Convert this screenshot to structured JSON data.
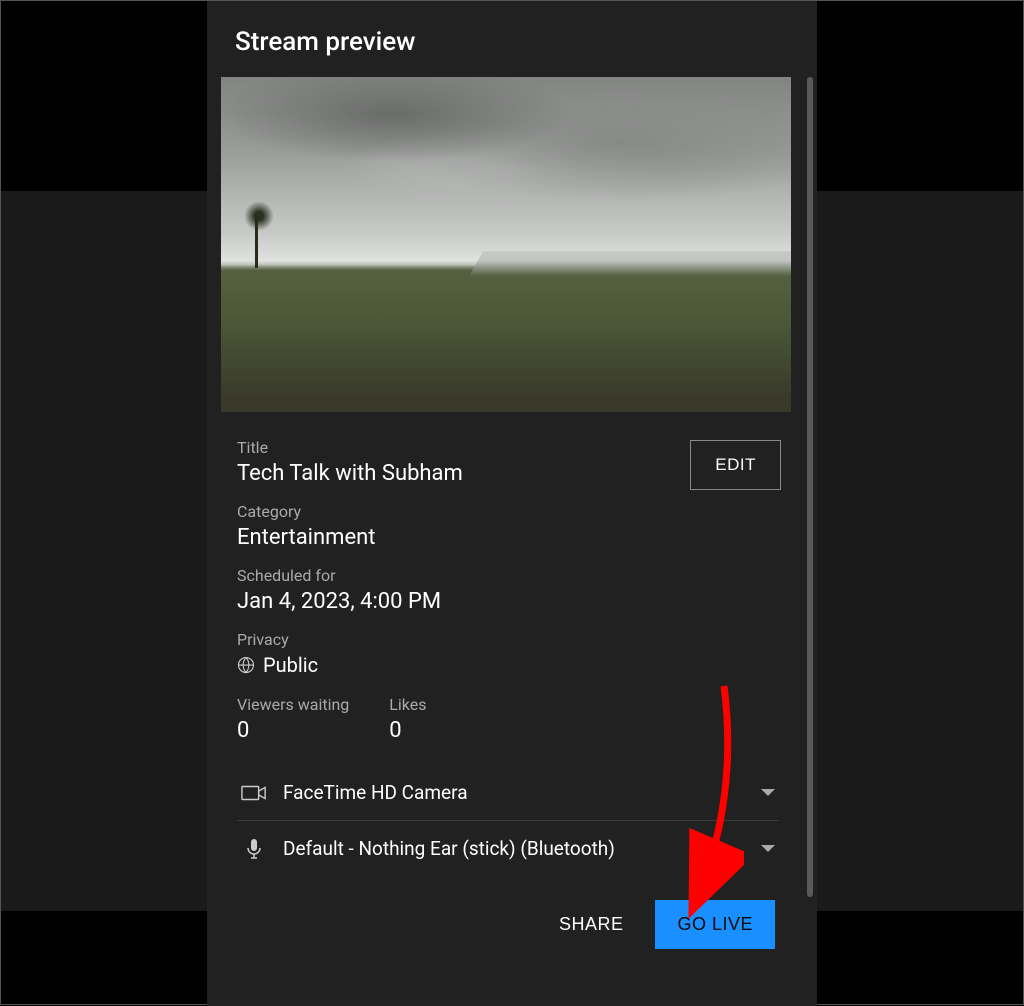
{
  "header": {
    "title": "Stream preview"
  },
  "details": {
    "title_label": "Title",
    "title_value": "Tech Talk with Subham",
    "edit_label": "EDIT",
    "category_label": "Category",
    "category_value": "Entertainment",
    "scheduled_label": "Scheduled for",
    "scheduled_value": "Jan 4, 2023, 4:00 PM",
    "privacy_label": "Privacy",
    "privacy_value": "Public"
  },
  "stats": {
    "viewers_label": "Viewers waiting",
    "viewers_value": "0",
    "likes_label": "Likes",
    "likes_value": "0"
  },
  "devices": {
    "camera": "FaceTime HD Camera",
    "microphone": "Default - Nothing Ear (stick) (Bluetooth)"
  },
  "actions": {
    "share": "SHARE",
    "golive": "GO LIVE"
  },
  "colors": {
    "accent": "#1a8fff",
    "annotation": "#ff0000"
  }
}
